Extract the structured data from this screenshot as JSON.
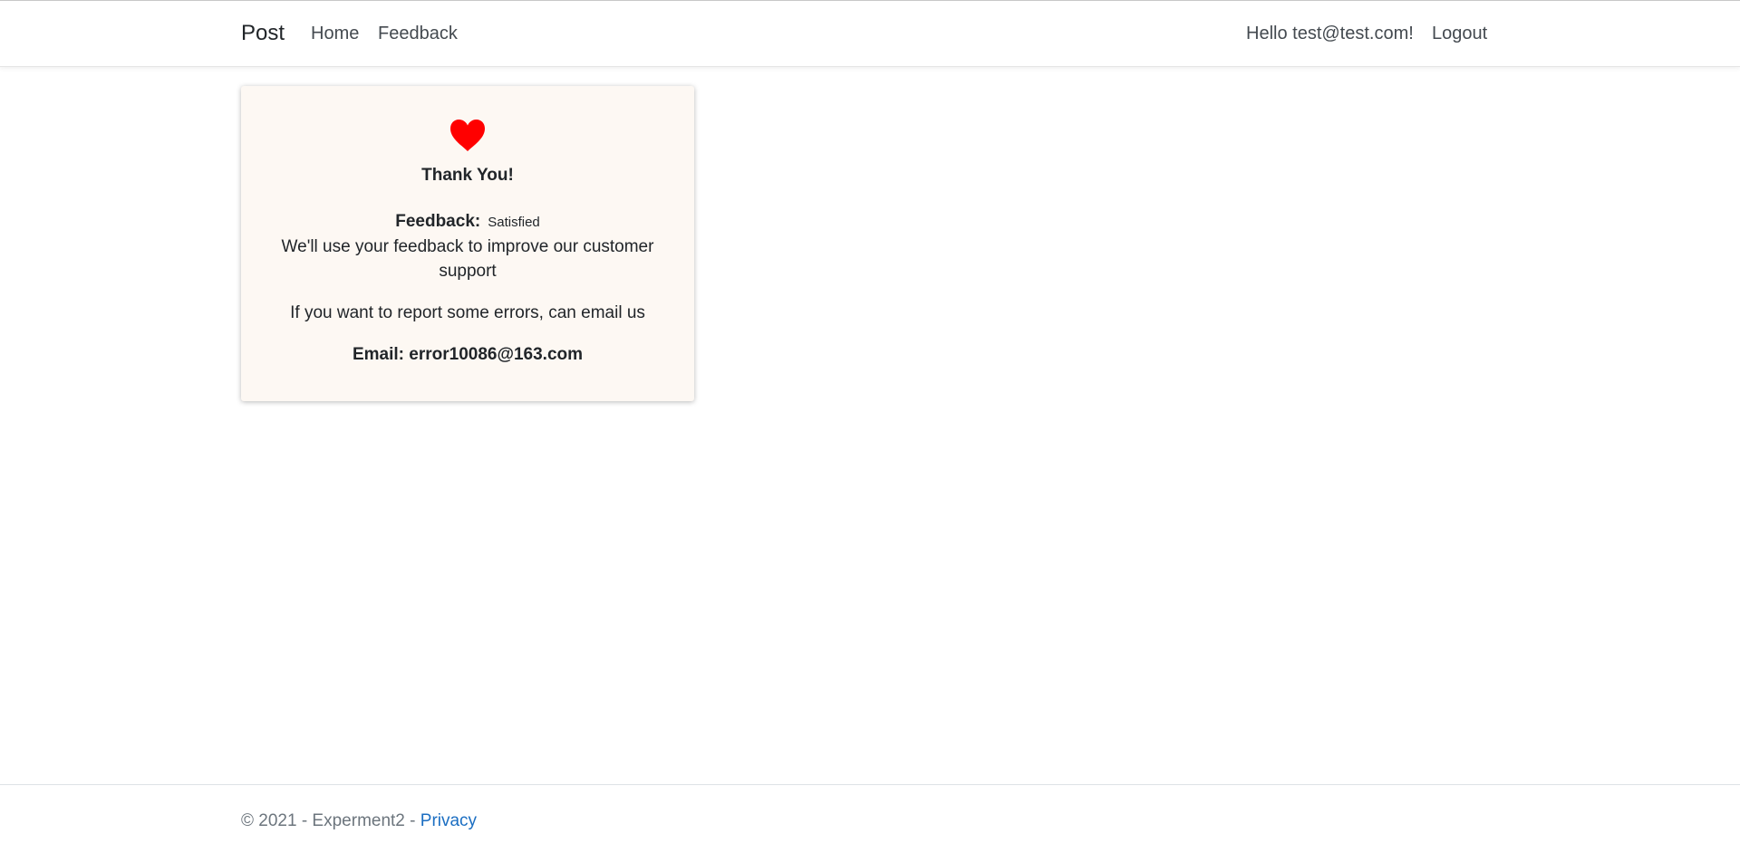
{
  "navbar": {
    "brand": "Post",
    "links": [
      {
        "label": "Home"
      },
      {
        "label": "Feedback"
      }
    ],
    "greeting": "Hello test@test.com!",
    "logout_label": "Logout"
  },
  "card": {
    "icon": "heart-icon",
    "heart_color": "#ff0000",
    "background": "#fdf8f3",
    "title": "Thank You!",
    "feedback_label": "Feedback:",
    "feedback_value": "Satisfied",
    "improve_text": "We'll use your feedback to improve our customer support",
    "report_text": "If you want to report some errors, can email us",
    "email_text": "Email: error10086@163.com"
  },
  "footer": {
    "copyright": "© 2021 - Experment2 - ",
    "privacy_label": "Privacy",
    "link_color": "#1b6ec2"
  }
}
